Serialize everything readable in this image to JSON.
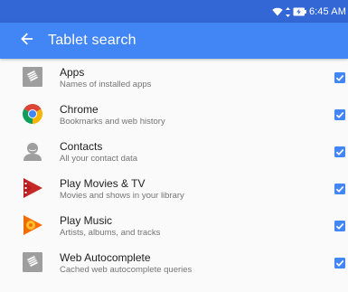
{
  "status_bar": {
    "time": "6:45 AM",
    "icons": [
      "wifi-icon",
      "data-arrows-icon",
      "battery-charging-icon"
    ]
  },
  "app_bar": {
    "title": "Tablet search",
    "back_icon": "back-arrow-icon"
  },
  "colors": {
    "status_bar": "#3367d6",
    "app_bar": "#4285f4",
    "checkbox": "#4285f4",
    "background": "#fafafa"
  },
  "items": [
    {
      "title": "Apps",
      "subtitle": "Names of installed apps",
      "icon": "apps-package-icon",
      "checked": true
    },
    {
      "title": "Chrome",
      "subtitle": "Bookmarks and web history",
      "icon": "chrome-icon",
      "checked": true
    },
    {
      "title": "Contacts",
      "subtitle": "All your contact data",
      "icon": "contacts-icon",
      "checked": true
    },
    {
      "title": "Play Movies & TV",
      "subtitle": "Movies and shows in your library",
      "icon": "play-movies-icon",
      "checked": true
    },
    {
      "title": "Play Music",
      "subtitle": "Artists, albums, and tracks",
      "icon": "play-music-icon",
      "checked": true
    },
    {
      "title": "Web Autocomplete",
      "subtitle": "Cached web autocomplete queries",
      "icon": "web-autocomplete-icon",
      "checked": true
    }
  ]
}
